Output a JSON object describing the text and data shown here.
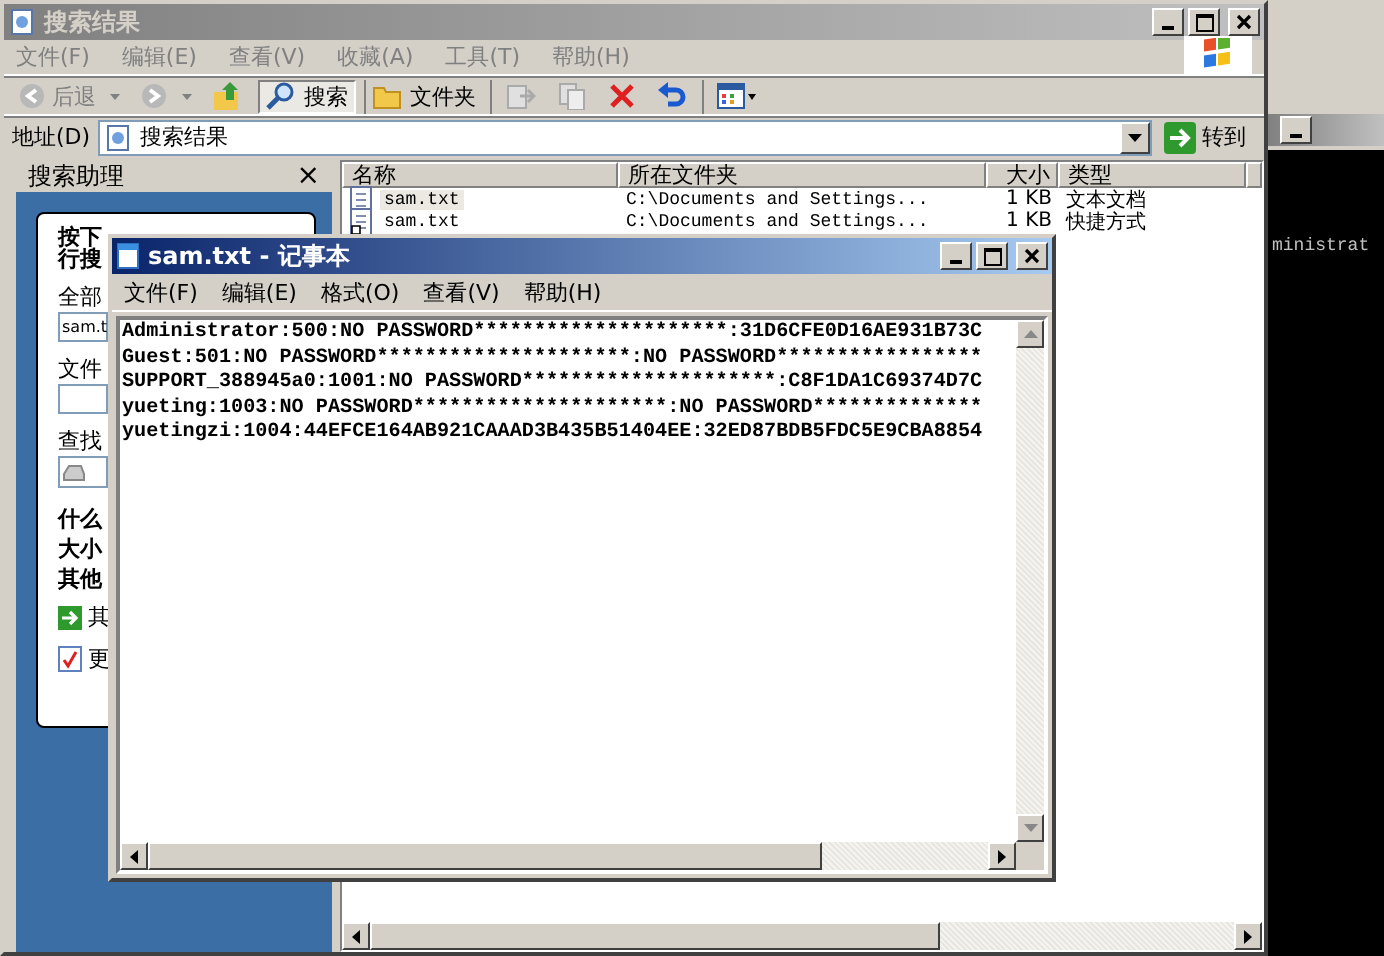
{
  "explorer": {
    "title": "搜索结果",
    "menu": [
      "文件(F)",
      "编辑(E)",
      "查看(V)",
      "收藏(A)",
      "工具(T)",
      "帮助(H)"
    ],
    "toolbar": [
      {
        "kind": "back",
        "label": "后退"
      },
      {
        "kind": "forward"
      },
      {
        "kind": "up"
      },
      {
        "kind": "search",
        "label": "搜索",
        "selected": true
      },
      {
        "kind": "folders",
        "label": "文件夹",
        "selected": false
      },
      {
        "kind": "move"
      },
      {
        "kind": "copy"
      },
      {
        "kind": "delete"
      },
      {
        "kind": "undo"
      },
      {
        "kind": "views"
      }
    ],
    "address": {
      "label": "地址(D)",
      "value": "搜索结果",
      "go": "转到"
    },
    "sidebar": {
      "title": "搜索助理",
      "close": "×",
      "items": [
        {
          "kind": "bold",
          "text": "按下"
        },
        {
          "kind": "bold",
          "text": "行搜"
        },
        {
          "kind": "label",
          "text": "全部"
        },
        {
          "kind": "field",
          "text": "sam.t"
        },
        {
          "kind": "label",
          "text": "文件"
        },
        {
          "kind": "field"
        },
        {
          "kind": "label",
          "text": "查找"
        },
        {
          "kind": "select"
        },
        {
          "kind": "bold",
          "text": "什么"
        },
        {
          "kind": "bold",
          "text": "大小"
        },
        {
          "kind": "bold",
          "text": "其他"
        },
        {
          "kind": "golink",
          "text": "其"
        },
        {
          "kind": "doclink",
          "text": "更"
        }
      ]
    },
    "list": {
      "columns": [
        "名称",
        "所在文件夹",
        "大小",
        "类型"
      ],
      "rows": [
        {
          "kind": "text",
          "name": "sam.txt",
          "folder": "C:\\Documents and Settings...",
          "size": "1 KB",
          "type": "文本文档",
          "selected": true
        },
        {
          "kind": "shortcut",
          "name": "sam.txt",
          "folder": "C:\\Documents and Settings...",
          "size": "1 KB",
          "type": "快捷方式",
          "selected": false
        }
      ]
    }
  },
  "notepad": {
    "title": "sam.txt - 记事本",
    "menu": [
      "文件(F)",
      "编辑(E)",
      "格式(O)",
      "查看(V)",
      "帮助(H)"
    ],
    "lines": [
      "Administrator:500:NO PASSWORD*********************:31D6CFE0D16AE931B73C",
      "Guest:501:NO PASSWORD*********************:NO PASSWORD*****************",
      "SUPPORT_388945a0:1001:NO PASSWORD*********************:C8F1DA1C69374D7C",
      "yueting:1003:NO PASSWORD*********************:NO PASSWORD**************",
      "yuetingzi:1004:44EFCE164AB921CAAAD3B435B51404EE:32ED87BDB5FDC5E9CBA8854"
    ]
  },
  "console": {
    "text": "ministrat"
  }
}
